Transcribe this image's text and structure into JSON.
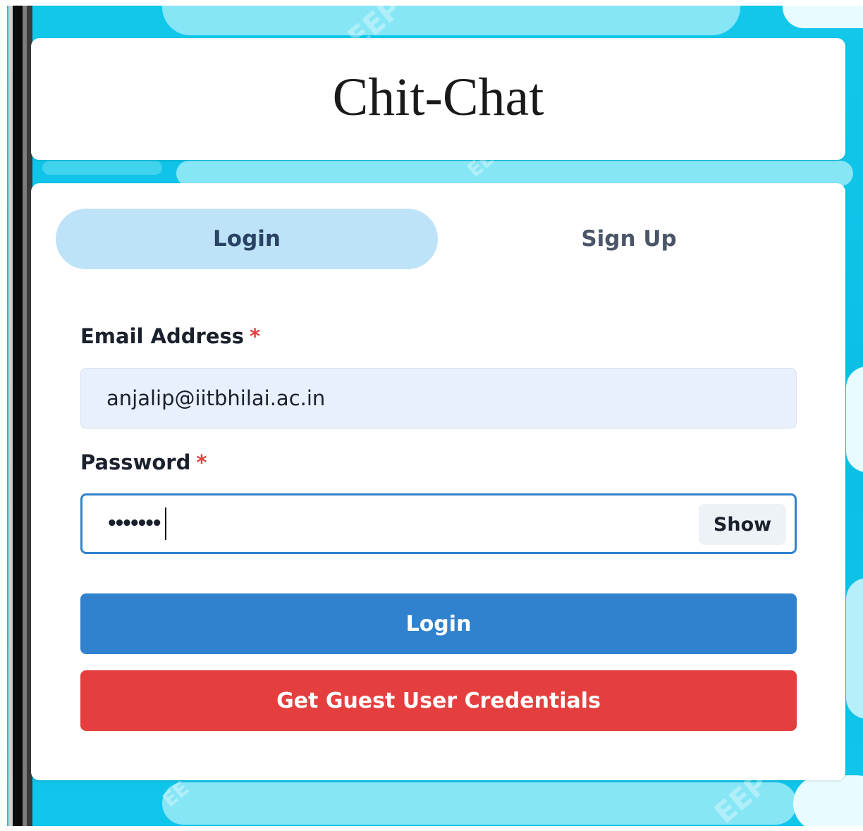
{
  "app": {
    "title": "Chit-Chat"
  },
  "tabs": [
    {
      "label": "Login",
      "selected": true
    },
    {
      "label": "Sign Up",
      "selected": false
    }
  ],
  "form": {
    "email": {
      "label": "Email Address",
      "required_mark": "*",
      "value": "anjalip@iitbhilai.ac.in"
    },
    "password": {
      "label": "Password",
      "required_mark": "*",
      "masked_value": "•••••••",
      "toggle_label": "Show"
    },
    "login_button": "Login",
    "guest_button": "Get Guest User Credentials"
  },
  "colors": {
    "tab_selected_bg": "#bee3f8",
    "primary": "#3182ce",
    "danger": "#e53e3e",
    "background": "#0bbfe4"
  }
}
